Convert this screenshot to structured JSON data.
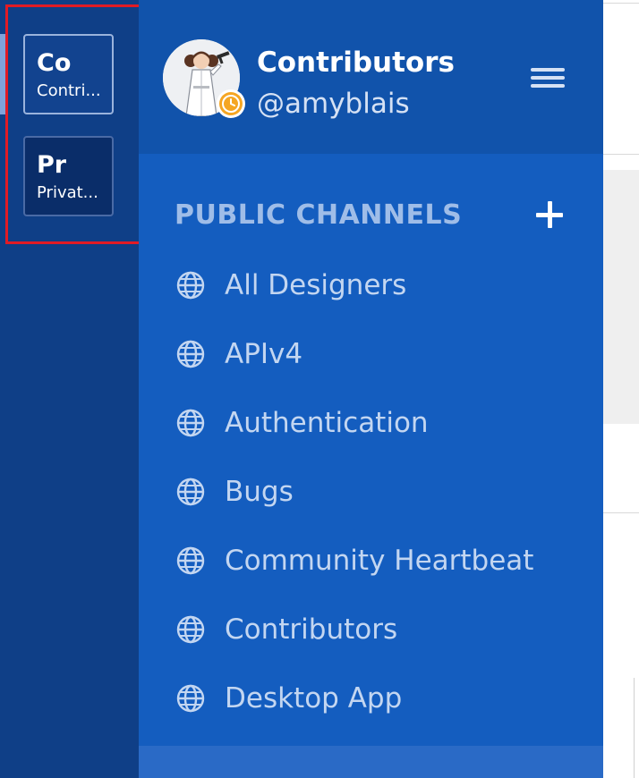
{
  "teams": [
    {
      "initials": "Co",
      "name": "Contri..."
    },
    {
      "initials": "Pr",
      "name": "Privat..."
    }
  ],
  "header": {
    "team_name": "Contributors",
    "username": "@amyblais",
    "status": "away",
    "status_icon": "clock-icon",
    "menu_icon": "hamburger-menu-icon"
  },
  "public_channels": {
    "title": "PUBLIC CHANNELS",
    "add_icon": "plus-icon",
    "channel_icon": "globe-icon",
    "items": [
      {
        "label": "All Designers"
      },
      {
        "label": "APIv4"
      },
      {
        "label": "Authentication"
      },
      {
        "label": "Bugs"
      },
      {
        "label": "Community Heartbeat"
      },
      {
        "label": "Contributors"
      },
      {
        "label": "Desktop App"
      }
    ]
  },
  "colors": {
    "team_sidebar_bg": "#0f3f87",
    "sidebar_bg": "#145dbf",
    "header_bg": "#1153ab",
    "away_status": "#f5a623",
    "highlight": "#e11b25"
  }
}
